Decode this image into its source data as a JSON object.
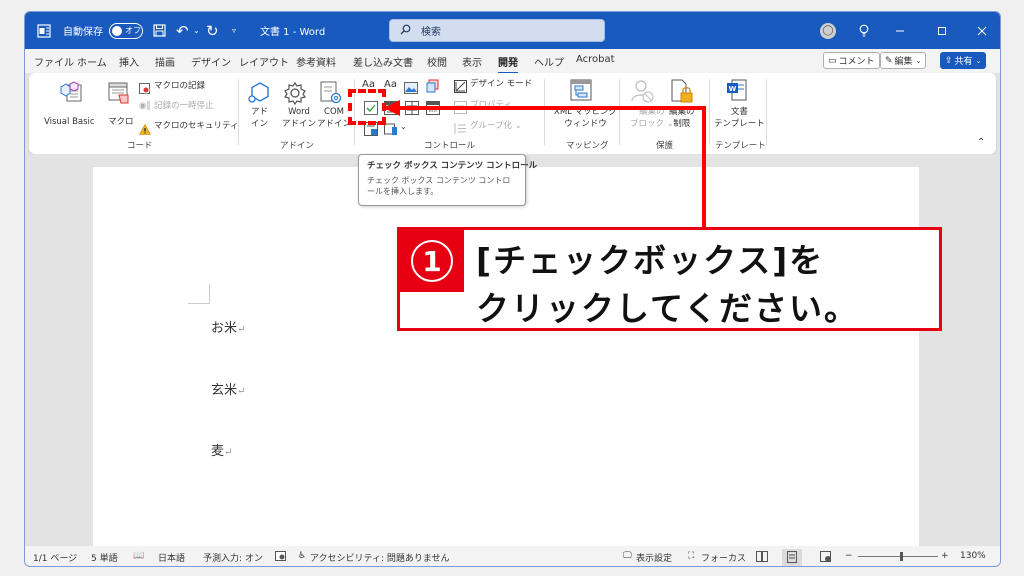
{
  "titlebar": {
    "autosave_label": "自動保存",
    "autosave_state": "オフ",
    "doc_title": "文書 1 - Word",
    "search_placeholder": "検索"
  },
  "menu": {
    "items": [
      "ファイル",
      "ホーム",
      "挿入",
      "描画",
      "デザイン",
      "レイアウト",
      "参考資料",
      "差し込み文書",
      "校閲",
      "表示",
      "開発",
      "ヘルプ",
      "Acrobat"
    ],
    "active": "開発",
    "comment_label": "コメント",
    "edit_label": "編集",
    "share_label": "共有"
  },
  "ribbon": {
    "code": {
      "visual_basic": "Visual Basic",
      "macro": "マクロ",
      "record_macro": "マクロの記録",
      "pause_recording": "記録の一時停止",
      "macro_security": "マクロのセキュリティ",
      "label": "コード"
    },
    "addins": {
      "addin_line1": "アド",
      "addin_line2": "イン",
      "word_line1": "Word",
      "word_line2": "アドイン",
      "com_line1": "COM",
      "com_line2": "アドイン",
      "label": "アドイン"
    },
    "controls": {
      "rich_text": "Aa",
      "plain_text": "Aa",
      "design_mode": "デザイン モード",
      "properties": "プロパティ",
      "group": "グループ化",
      "label": "コントロール"
    },
    "mapping": {
      "xml_line1": "XML マッピング",
      "xml_line2": "ウィンドウ",
      "label": "マッピング"
    },
    "protect": {
      "block_line1": "編集の",
      "block_line2": "ブロック",
      "restrict_line1": "編集の",
      "restrict_line2": "制限",
      "label": "保護"
    },
    "templates": {
      "doc_line1": "文書",
      "doc_line2": "テンプレート",
      "label": "テンプレート"
    }
  },
  "tooltip": {
    "title": "チェック ボックス コンテンツ コントロール",
    "description": "チェック ボックス コンテンツ コントロールを挿入します。"
  },
  "document": {
    "paragraphs": [
      "お米",
      "玄米",
      "麦"
    ],
    "para_mark": "↵"
  },
  "callout": {
    "number": "1",
    "line1": "[チェックボックス]を",
    "line2": "クリックしてください。"
  },
  "statusbar": {
    "page": "1/1 ページ",
    "words": "5 単語",
    "language": "日本語",
    "predictive": "予測入力: オン",
    "accessibility": "アクセシビリティ: 問題ありません",
    "display_settings": "表示設定",
    "focus": "フォーカス",
    "zoom_minus": "−",
    "zoom_plus": "+",
    "zoom_level": "130%",
    "zoom_percent": 130
  },
  "colors": {
    "title_blue": "#185abd",
    "callout_red": "#e60012"
  }
}
